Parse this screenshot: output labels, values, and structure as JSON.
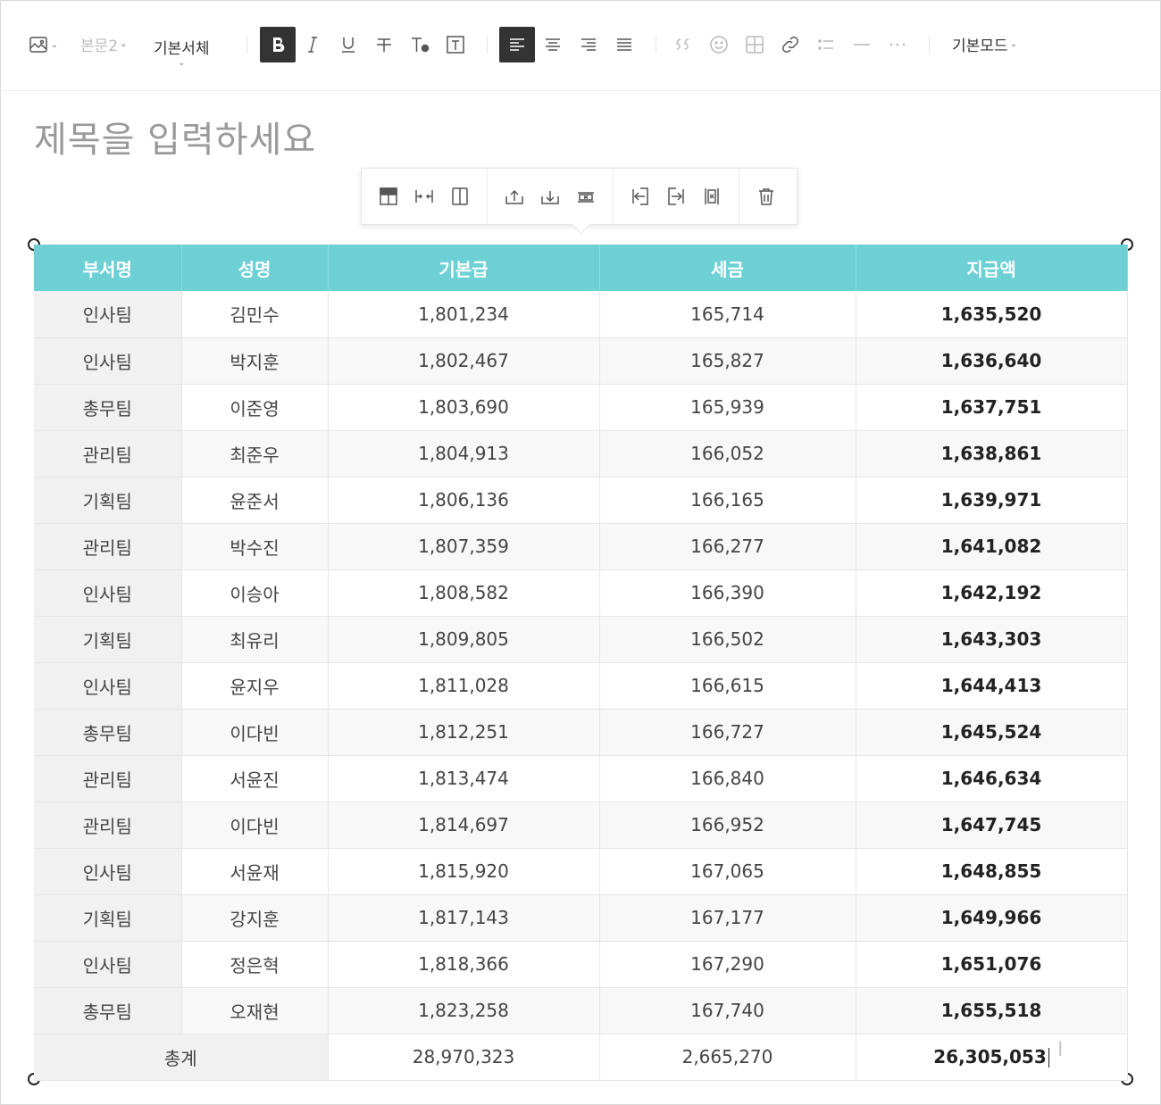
{
  "toolbar": {
    "style_label": "본문2",
    "font_label": "기본서체",
    "mode_label": "기본모드"
  },
  "title": {
    "placeholder": "제목을 입력하세요"
  },
  "table": {
    "headers": [
      "부서명",
      "성명",
      "기본급",
      "세금",
      "지급액"
    ],
    "rows": [
      [
        "인사팀",
        "김민수",
        "1,801,234",
        "165,714",
        "1,635,520"
      ],
      [
        "인사팀",
        "박지훈",
        "1,802,467",
        "165,827",
        "1,636,640"
      ],
      [
        "총무팀",
        "이준영",
        "1,803,690",
        "165,939",
        "1,637,751"
      ],
      [
        "관리팀",
        "최준우",
        "1,804,913",
        "166,052",
        "1,638,861"
      ],
      [
        "기획팀",
        "윤준서",
        "1,806,136",
        "166,165",
        "1,639,971"
      ],
      [
        "관리팀",
        "박수진",
        "1,807,359",
        "166,277",
        "1,641,082"
      ],
      [
        "인사팀",
        "이승아",
        "1,808,582",
        "166,390",
        "1,642,192"
      ],
      [
        "기획팀",
        "최유리",
        "1,809,805",
        "166,502",
        "1,643,303"
      ],
      [
        "인사팀",
        "윤지우",
        "1,811,028",
        "166,615",
        "1,644,413"
      ],
      [
        "총무팀",
        "이다빈",
        "1,812,251",
        "166,727",
        "1,645,524"
      ],
      [
        "관리팀",
        "서윤진",
        "1,813,474",
        "166,840",
        "1,646,634"
      ],
      [
        "관리팀",
        "이다빈",
        "1,814,697",
        "166,952",
        "1,647,745"
      ],
      [
        "인사팀",
        "서윤재",
        "1,815,920",
        "167,065",
        "1,648,855"
      ],
      [
        "기획팀",
        "강지훈",
        "1,817,143",
        "167,177",
        "1,649,966"
      ],
      [
        "인사팀",
        "정은혁",
        "1,818,366",
        "167,290",
        "1,651,076"
      ],
      [
        "총무팀",
        "오재현",
        "1,823,258",
        "167,740",
        "1,655,518"
      ]
    ],
    "sum": {
      "label": "총계",
      "base": "28,970,323",
      "tax": "2,665,270",
      "net": "26,305,053"
    }
  },
  "colors": {
    "header_bg": "#6cd0d4",
    "dept_bg": "#f1f1f1",
    "active_button": "#333333"
  }
}
